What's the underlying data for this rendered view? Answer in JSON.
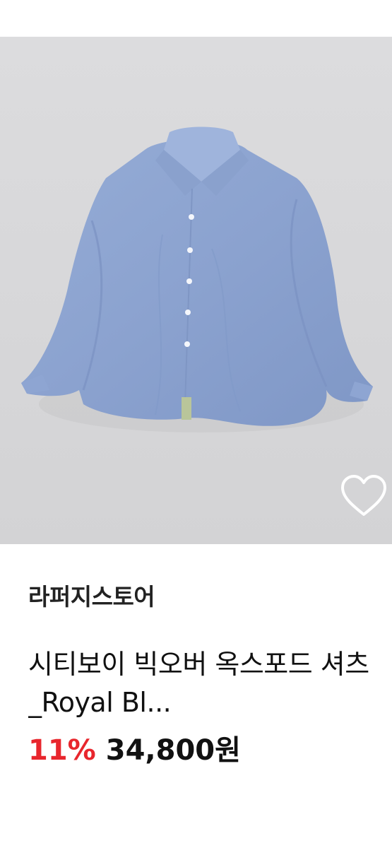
{
  "product": {
    "image_alt": "light blue oxford shirt",
    "seller": "라퍼지스토어",
    "title": "시티보이 빅오버 옥스포드 셔츠_Royal Bl...",
    "discount": "11%",
    "price": "34,800원"
  },
  "colors": {
    "discount": "#e8262d",
    "image_bg": "#d9d9db",
    "shirt": "#8ea6d2"
  },
  "icons": {
    "wishlist": "heart-outline-icon"
  }
}
